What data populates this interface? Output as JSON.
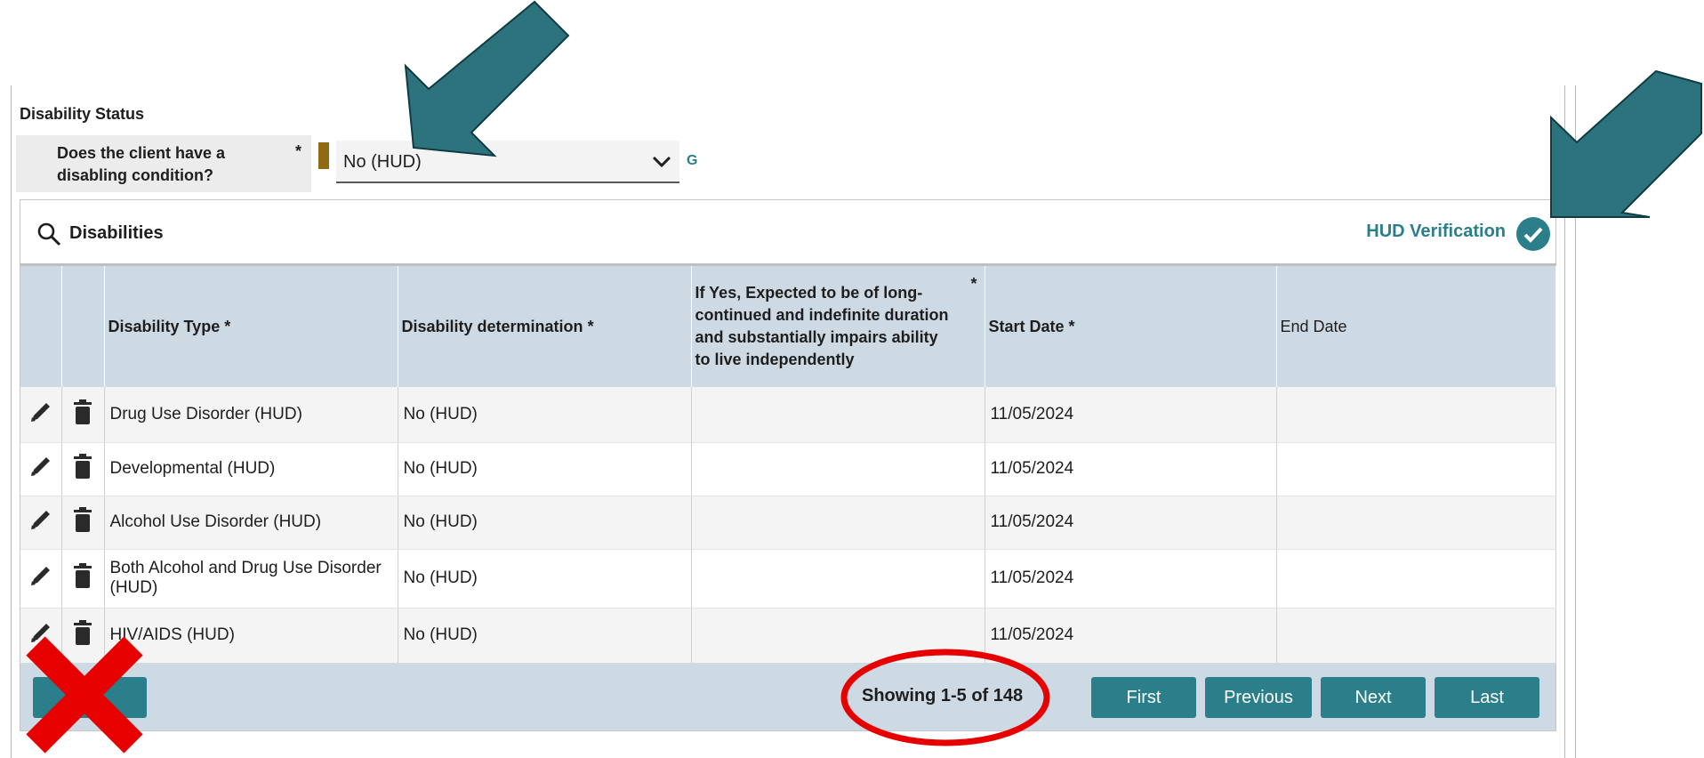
{
  "section": {
    "title": "Disability Status"
  },
  "question": {
    "label": "Does the client have a disabling condition?",
    "required_mark": "*",
    "value": "No (HUD)",
    "suffix": "G"
  },
  "panel": {
    "title": "Disabilities",
    "hud_verification": "HUD Verification",
    "columns": [
      {
        "label": "Disability Type",
        "required": "*"
      },
      {
        "label": "Disability determination",
        "required": "*"
      },
      {
        "label": "If Yes, Expected to be of long-continued and indefinite duration and substantially impairs ability to live independently",
        "required": "*"
      },
      {
        "label": "Start Date",
        "required": "*"
      },
      {
        "label": "End Date",
        "required": ""
      }
    ],
    "rows": [
      {
        "type": "Drug Use Disorder (HUD)",
        "determination": "No (HUD)",
        "long_term": "",
        "start": "11/05/2024",
        "end": ""
      },
      {
        "type": "Developmental (HUD)",
        "determination": "No (HUD)",
        "long_term": "",
        "start": "11/05/2024",
        "end": ""
      },
      {
        "type": "Alcohol Use Disorder (HUD)",
        "determination": "No (HUD)",
        "long_term": "",
        "start": "11/05/2024",
        "end": ""
      },
      {
        "type": "Both Alcohol and Drug Use Disorder (HUD)",
        "determination": "No (HUD)",
        "long_term": "",
        "start": "11/05/2024",
        "end": ""
      },
      {
        "type": "HIV/AIDS (HUD)",
        "determination": "No (HUD)",
        "long_term": "",
        "start": "11/05/2024",
        "end": ""
      }
    ],
    "pagination": {
      "showing": "Showing 1-5 of 148",
      "first": "First",
      "previous": "Previous",
      "next": "Next",
      "last": "Last"
    }
  },
  "colors": {
    "accent": "#2b7f8a",
    "header_bg": "#cdd9e3",
    "annotation_arrow": "#2d737d",
    "annotation_red": "#e00000"
  },
  "icons": [
    "search-icon",
    "pencil-icon",
    "trash-icon",
    "check-icon",
    "chevron-down-icon"
  ]
}
